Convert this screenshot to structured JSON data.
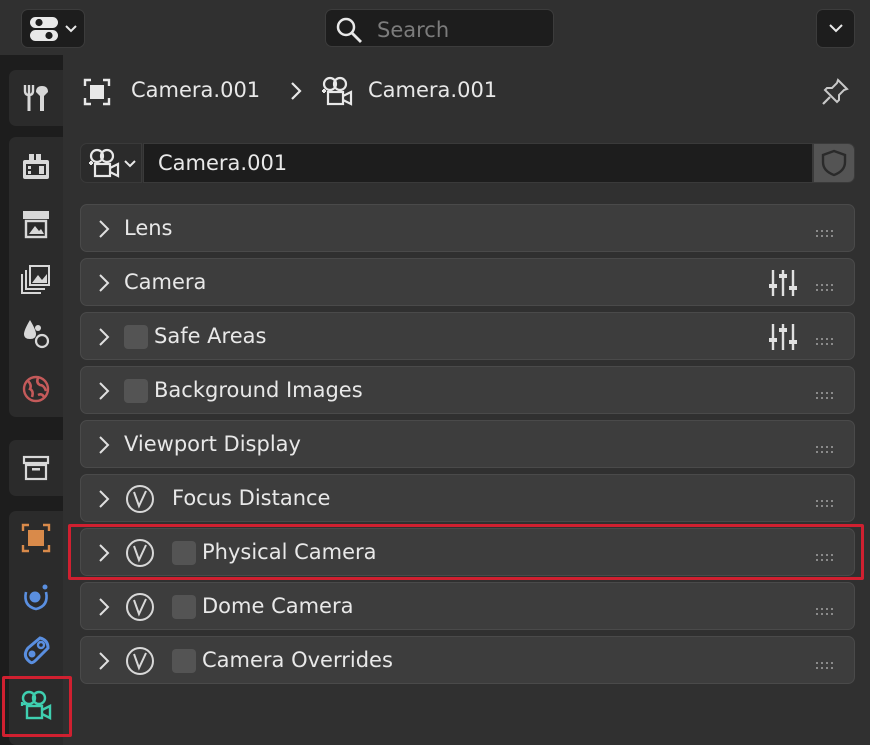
{
  "header": {
    "search": {
      "placeholder": "Search",
      "icon": "search-icon"
    },
    "editor_type_icon": "properties-editor-icon",
    "options_icon": "chevron-down-icon"
  },
  "breadcrumb": {
    "object_name": "Camera.001",
    "data_name": "Camera.001",
    "pin_icon": "pin-icon"
  },
  "datablock": {
    "name": "Camera.001",
    "type_icon": "camera-data-icon",
    "fake_user_icon": "shield-icon"
  },
  "sidebar": {
    "tabs": [
      {
        "id": "tool",
        "icon": "tool-icon"
      },
      {
        "id": "render",
        "icon": "render-icon"
      },
      {
        "id": "output",
        "icon": "output-icon"
      },
      {
        "id": "view-layer",
        "icon": "view-layer-icon"
      },
      {
        "id": "scene",
        "icon": "scene-icon"
      },
      {
        "id": "world",
        "icon": "world-icon"
      },
      {
        "id": "collection",
        "icon": "collection-icon"
      },
      {
        "id": "object",
        "icon": "object-icon"
      },
      {
        "id": "physics",
        "icon": "physics-icon"
      },
      {
        "id": "constraints",
        "icon": "constraints-icon"
      },
      {
        "id": "camera-data",
        "icon": "camera-data-icon",
        "active": true
      }
    ]
  },
  "panels": [
    {
      "label": "Lens",
      "checkbox": false,
      "anim": false,
      "presets": false
    },
    {
      "label": "Camera",
      "checkbox": false,
      "anim": false,
      "presets": true
    },
    {
      "label": "Safe Areas",
      "checkbox": true,
      "anim": false,
      "presets": true
    },
    {
      "label": "Background Images",
      "checkbox": true,
      "anim": false,
      "presets": false
    },
    {
      "label": "Viewport Display",
      "checkbox": false,
      "anim": false,
      "presets": false
    },
    {
      "label": "Focus Distance",
      "checkbox": false,
      "anim": true,
      "presets": false
    },
    {
      "label": "Physical Camera",
      "checkbox": true,
      "anim": true,
      "presets": false,
      "highlighted": true
    },
    {
      "label": "Dome Camera",
      "checkbox": true,
      "anim": true,
      "presets": false
    },
    {
      "label": "Camera Overrides",
      "checkbox": true,
      "anim": true,
      "presets": false
    }
  ],
  "colors": {
    "accent_active_tab": "#3fcfb0",
    "highlight": "#d02030",
    "object_orange": "#d98a4a",
    "world_red": "#c45a5a",
    "physics_blue": "#5a8fe0"
  }
}
